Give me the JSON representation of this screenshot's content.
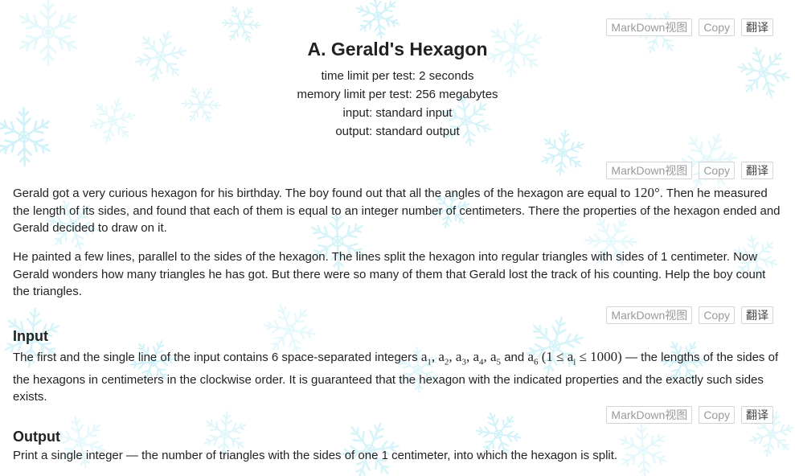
{
  "toolbar": {
    "markdown_label": "MarkDown视图",
    "copy_label": "Copy",
    "translate_label": "翻译"
  },
  "problem": {
    "title": "A. Gerald's Hexagon",
    "time_limit": "time limit per test: 2 seconds",
    "memory_limit": "memory limit per test: 256 megabytes",
    "input": "input: standard input",
    "output": "output: standard output"
  },
  "statement": {
    "p1_start": "Gerald got a very curious hexagon for his birthday. The boy found out that all the angles of the hexagon are equal to ",
    "p1_angle": "120°",
    "p1_end": ". Then he measured the length of its sides, and found that each of them is equal to an integer number of centimeters. There the properties of the hexagon ended and Gerald decided to draw on it.",
    "p2": "He painted a few lines, parallel to the sides of the hexagon. The lines split the hexagon into regular triangles with sides of 1 centimeter. Now Gerald wonders how many triangles he has got. But there were so many of them that Gerald lost the track of his counting. Help the boy count the triangles."
  },
  "input_section": {
    "title": "Input",
    "text_start": "The first and the single line of the input contains 6 space-separated integers ",
    "vars": "a1, a2, a3, a4, a5",
    "and": " and ",
    "last_var": "a6",
    "constraint": " (1 ≤ ai ≤ 1000)",
    "text_end": " — the lengths of the sides of the hexagons in centimeters in the clockwise order. It is guaranteed that the hexagon with the indicated properties and the exactly such sides exists."
  },
  "output_section": {
    "title": "Output",
    "text": "Print a single integer — the number of triangles with the sides of one 1 centimeter, into which the hexagon is split."
  }
}
